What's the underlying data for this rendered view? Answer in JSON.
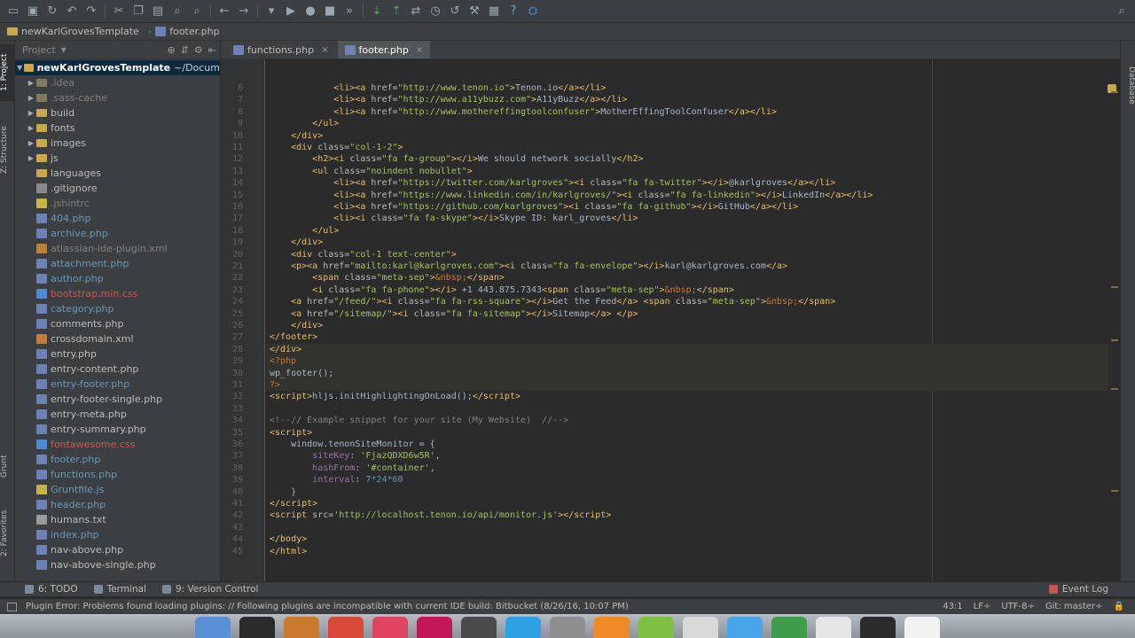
{
  "breadcrumb": {
    "project": "newKarlGrovesTemplate",
    "file": "footer.php"
  },
  "toolbar": {
    "icons": [
      "open-folder-icon",
      "save-icon",
      "sync-icon",
      "undo-icon",
      "redo-icon",
      "cut-icon",
      "copy-icon",
      "paste-icon",
      "find-icon",
      "replace-icon",
      "back-icon",
      "forward-icon",
      "run-config-icon",
      "run-icon",
      "debug-icon",
      "stop-icon",
      "step-icon",
      "vcs-update-icon",
      "vcs-commit-icon",
      "vcs-compare-icon",
      "vcs-history-icon",
      "revert-icon",
      "settings-icon",
      "structure-icon",
      "help-icon",
      "plugin-icon",
      "search-everywhere-icon"
    ]
  },
  "left_strip": {
    "project_tab": "1: Project",
    "structure_tab": "Z: Structure",
    "grunt_tab": "Grunt",
    "favorites_tab": "2: Favorites"
  },
  "right_strip": {
    "database_tab": "Database"
  },
  "project_panel": {
    "header": "Project",
    "root": "newKarlGrovesTemplate",
    "root_path": "~/Docum",
    "items": [
      {
        "name": ".idea",
        "kind": "folder",
        "dim": true,
        "expandable": true
      },
      {
        "name": ".sass-cache",
        "kind": "folder",
        "dim": true,
        "expandable": true
      },
      {
        "name": "build",
        "kind": "folder",
        "expandable": true
      },
      {
        "name": "fonts",
        "kind": "folder",
        "expandable": true
      },
      {
        "name": "images",
        "kind": "folder",
        "expandable": true
      },
      {
        "name": "js",
        "kind": "folder",
        "expandable": true
      },
      {
        "name": "languages",
        "kind": "folder",
        "expandable": false
      },
      {
        "name": ".gitignore",
        "kind": "git",
        "color": "white"
      },
      {
        "name": ".jshintrc",
        "kind": "js",
        "color": "gray"
      },
      {
        "name": "404.php",
        "kind": "php",
        "color": "blue"
      },
      {
        "name": "archive.php",
        "kind": "php",
        "color": "blue"
      },
      {
        "name": "atlassian-ide-plugin.xml",
        "kind": "xml",
        "color": "gray"
      },
      {
        "name": "attachment.php",
        "kind": "php",
        "color": "blue"
      },
      {
        "name": "author.php",
        "kind": "php",
        "color": "blue"
      },
      {
        "name": "bootstrap.min.css",
        "kind": "css",
        "color": "red"
      },
      {
        "name": "category.php",
        "kind": "php",
        "color": "blue"
      },
      {
        "name": "comments.php",
        "kind": "php",
        "color": "white"
      },
      {
        "name": "crossdomain.xml",
        "kind": "xml",
        "color": "white"
      },
      {
        "name": "entry.php",
        "kind": "php",
        "color": "white"
      },
      {
        "name": "entry-content.php",
        "kind": "php",
        "color": "white"
      },
      {
        "name": "entry-footer.php",
        "kind": "php",
        "color": "blue"
      },
      {
        "name": "entry-footer-single.php",
        "kind": "php",
        "color": "white"
      },
      {
        "name": "entry-meta.php",
        "kind": "php",
        "color": "white"
      },
      {
        "name": "entry-summary.php",
        "kind": "php",
        "color": "white"
      },
      {
        "name": "fontawesome.css",
        "kind": "css",
        "color": "red"
      },
      {
        "name": "footer.php",
        "kind": "php",
        "color": "blue"
      },
      {
        "name": "functions.php",
        "kind": "php",
        "color": "blue"
      },
      {
        "name": "Gruntfile.js",
        "kind": "js",
        "color": "blue"
      },
      {
        "name": "header.php",
        "kind": "php",
        "color": "blue"
      },
      {
        "name": "humans.txt",
        "kind": "txt",
        "color": "white"
      },
      {
        "name": "index.php",
        "kind": "php",
        "color": "blue"
      },
      {
        "name": "nav-above.php",
        "kind": "php",
        "color": "white"
      },
      {
        "name": "nav-above-single.php",
        "kind": "php",
        "color": "white"
      }
    ]
  },
  "editor_tabs": [
    {
      "label": "functions.php",
      "active": false
    },
    {
      "label": "footer.php",
      "active": true
    }
  ],
  "code_lines": [
    {
      "n": "6",
      "h": "            <span class=\"tag\">&lt;li&gt;&lt;a </span><span class=\"attr\">href=</span><span class=\"str\">\"http://www.tenon.io\"</span><span class=\"tag\">&gt;</span><span class=\"txt\">Tenon.io</span><span class=\"tag\">&lt;/a&gt;&lt;/li&gt;</span>"
    },
    {
      "n": "7",
      "h": "            <span class=\"tag\">&lt;li&gt;&lt;a </span><span class=\"attr\">href=</span><span class=\"str\">\"http://www.a11ybuzz.com\"</span><span class=\"tag\">&gt;</span><span class=\"txt\">A11yBuzz</span><span class=\"tag\">&lt;/a&gt;&lt;/li&gt;</span>"
    },
    {
      "n": "8",
      "h": "            <span class=\"tag\">&lt;li&gt;&lt;a </span><span class=\"attr\">href=</span><span class=\"str\">\"http://www.mothereffingtoolconfuser\"</span><span class=\"tag\">&gt;</span><span class=\"txt\">MotherEffingToolConfuser</span><span class=\"tag\">&lt;/a&gt;&lt;/li&gt;</span>"
    },
    {
      "n": "9",
      "h": "        <span class=\"tag\">&lt;/ul&gt;</span>"
    },
    {
      "n": "10",
      "h": "    <span class=\"tag\">&lt;/div&gt;</span>"
    },
    {
      "n": "11",
      "h": "    <span class=\"tag\">&lt;div </span><span class=\"attr\">class=</span><span class=\"str\">\"col-1-2\"</span><span class=\"tag\">&gt;</span>"
    },
    {
      "n": "12",
      "h": "        <span class=\"tag\">&lt;h2&gt;&lt;i </span><span class=\"attr\">class=</span><span class=\"str\">\"fa fa-group\"</span><span class=\"tag\">&gt;&lt;/i&gt;</span><span class=\"txt\">We should network socially</span><span class=\"tag\">&lt;/h2&gt;</span>"
    },
    {
      "n": "13",
      "h": "        <span class=\"tag\">&lt;ul </span><span class=\"attr\">class=</span><span class=\"str\">\"noindent nobullet\"</span><span class=\"tag\">&gt;</span>"
    },
    {
      "n": "14",
      "h": "            <span class=\"tag\">&lt;li&gt;&lt;a </span><span class=\"attr\">href=</span><span class=\"str\">\"https://twitter.com/karlgroves\"</span><span class=\"tag\">&gt;&lt;i </span><span class=\"attr\">class=</span><span class=\"str\">\"fa fa-twitter\"</span><span class=\"tag\">&gt;&lt;/i&gt;</span><span class=\"txt\">@karlgroves</span><span class=\"tag\">&lt;/a&gt;&lt;/li&gt;</span>"
    },
    {
      "n": "15",
      "h": "            <span class=\"tag\">&lt;li&gt;&lt;a </span><span class=\"attr\">href=</span><span class=\"str\">\"https://www.linkedin.com/in/karlgroves/\"</span><span class=\"tag\">&gt;&lt;i </span><span class=\"attr\">class=</span><span class=\"str\">\"fa fa-linkedin\"</span><span class=\"tag\">&gt;&lt;/i&gt;</span><span class=\"txt\">LinkedIn</span><span class=\"tag\">&lt;/a&gt;&lt;/li&gt;</span>"
    },
    {
      "n": "16",
      "h": "            <span class=\"tag\">&lt;li&gt;&lt;a </span><span class=\"attr\">href=</span><span class=\"str\">\"https://github.com/karlgroves\"</span><span class=\"tag\">&gt;&lt;i </span><span class=\"attr\">class=</span><span class=\"str\">\"fa fa-github\"</span><span class=\"tag\">&gt;&lt;/i&gt;</span><span class=\"txt\">GitHub</span><span class=\"tag\">&lt;/a&gt;&lt;/li&gt;</span>"
    },
    {
      "n": "17",
      "h": "            <span class=\"tag\">&lt;li&gt;&lt;i </span><span class=\"attr\">class=</span><span class=\"str\">\"fa fa-skype\"</span><span class=\"tag\">&gt;&lt;/i&gt;</span><span class=\"txt\">Skype ID: karl_groves</span><span class=\"tag\">&lt;/li&gt;</span>"
    },
    {
      "n": "18",
      "h": "        <span class=\"tag\">&lt;/ul&gt;</span>"
    },
    {
      "n": "19",
      "h": "    <span class=\"tag\">&lt;/div&gt;</span>"
    },
    {
      "n": "20",
      "h": "    <span class=\"tag\">&lt;div </span><span class=\"attr\">class=</span><span class=\"str\">\"col-1 text-center\"</span><span class=\"tag\">&gt;</span>"
    },
    {
      "n": "21",
      "h": "    <span class=\"tag\">&lt;p&gt;&lt;a </span><span class=\"attr\">href=</span><span class=\"str\">\"mailto:karl@karlgroves.com\"</span><span class=\"tag\">&gt;&lt;i </span><span class=\"attr\">class=</span><span class=\"str\">\"fa fa-envelope\"</span><span class=\"tag\">&gt;&lt;/i&gt;</span><span class=\"txt\">karl@karlgroves.com</span><span class=\"tag\">&lt;/a&gt;</span>"
    },
    {
      "n": "22",
      "h": "        <span class=\"tag\">&lt;span </span><span class=\"attr\">class=</span><span class=\"str\">\"meta-sep\"</span><span class=\"tag\">&gt;</span><span class=\"php\">&amp;nbsp;</span><span class=\"tag\">&lt;/span&gt;</span>"
    },
    {
      "n": "23",
      "h": "        <span class=\"tag\">&lt;i </span><span class=\"attr\">class=</span><span class=\"str\">\"fa fa-phone\"</span><span class=\"tag\">&gt;&lt;/i&gt;</span><span class=\"txt\"> +1 443.875.7343</span><span class=\"tag\">&lt;span </span><span class=\"attr\">class=</span><span class=\"str\">\"meta-sep\"</span><span class=\"tag\">&gt;</span><span class=\"php\">&amp;nbsp;</span><span class=\"tag\">&lt;/span&gt;</span>"
    },
    {
      "n": "24",
      "h": "    <span class=\"tag\">&lt;a </span><span class=\"attr\">href=</span><span class=\"str\">\"/feed/\"</span><span class=\"tag\">&gt;&lt;i </span><span class=\"attr\">class=</span><span class=\"str\">\"fa fa-rss-square\"</span><span class=\"tag\">&gt;&lt;/i&gt;</span><span class=\"txt\">Get the Feed</span><span class=\"tag\">&lt;/a&gt; &lt;span </span><span class=\"attr\">class=</span><span class=\"str\">\"meta-sep\"</span><span class=\"tag\">&gt;</span><span class=\"php\">&amp;nbsp;</span><span class=\"tag\">&lt;/span&gt;</span>"
    },
    {
      "n": "25",
      "h": "    <span class=\"tag\">&lt;a </span><span class=\"attr\">href=</span><span class=\"str\">\"/sitemap/\"</span><span class=\"tag\">&gt;&lt;i </span><span class=\"attr\">class=</span><span class=\"str\">\"fa fa-sitemap\"</span><span class=\"tag\">&gt;&lt;/i&gt;</span><span class=\"txt\">Sitemap</span><span class=\"tag\">&lt;/a&gt; &lt;/p&gt;</span>"
    },
    {
      "n": "26",
      "h": "    <span class=\"tag\">&lt;/div&gt;</span>"
    },
    {
      "n": "27",
      "h": "<span class=\"tag\">&lt;/footer&gt;</span>"
    },
    {
      "n": "28",
      "h": "<span class=\"tag\">&lt;/div&gt;</span>"
    },
    {
      "n": "29",
      "h": "<span class=\"php\">&lt;?php</span>"
    },
    {
      "n": "30",
      "h": "<span class=\"txt\">wp_footer();</span>"
    },
    {
      "n": "31",
      "h": "<span class=\"php\">?&gt;</span>"
    },
    {
      "n": "32",
      "h": "<span class=\"tag\">&lt;script&gt;</span><span class=\"txt\">hljs.initHighlightingOnLoad();</span><span class=\"tag\">&lt;/script&gt;</span>"
    },
    {
      "n": "33",
      "h": ""
    },
    {
      "n": "34",
      "h": "<span class=\"cmt\">&lt;!--// Example snippet for your site (My Website)  //--&gt;</span>"
    },
    {
      "n": "35",
      "h": "<span class=\"tag\">&lt;script&gt;</span>"
    },
    {
      "n": "36",
      "h": "    <span class=\"txt\">window.tenonSiteMonitor = {</span>"
    },
    {
      "n": "37",
      "h": "        <span class=\"prop\">siteKey</span><span class=\"txt\">: </span><span class=\"str\">'FjazQDXD6w5R'</span><span class=\"txt\">,</span>"
    },
    {
      "n": "38",
      "h": "        <span class=\"prop\">hashFrom</span><span class=\"txt\">: </span><span class=\"str\">'#container'</span><span class=\"txt\">,</span>"
    },
    {
      "n": "39",
      "h": "        <span class=\"prop\">interval</span><span class=\"txt\">: </span><span class=\"num\">7*24*60</span>"
    },
    {
      "n": "40",
      "h": "    <span class=\"txt\">}</span>"
    },
    {
      "n": "41",
      "h": "<span class=\"tag\">&lt;/script&gt;</span>"
    },
    {
      "n": "42",
      "h": "<span class=\"tag\">&lt;script </span><span class=\"attr\">src=</span><span class=\"str\">'http://localhost.tenon.io/api/monitor.js'</span><span class=\"tag\">&gt;&lt;/script&gt;</span>"
    },
    {
      "n": "43",
      "h": ""
    },
    {
      "n": "44",
      "h": "<span class=\"tag\">&lt;/body&gt;</span>"
    },
    {
      "n": "45",
      "h": "<span class=\"tag\">&lt;/html&gt;</span>"
    }
  ],
  "bottom_tabs": {
    "todo": "6: TODO",
    "terminal": "Terminal",
    "vcs": "9: Version Control",
    "event_log": "Event Log"
  },
  "status": {
    "message": "Plugin Error: Problems found loading plugins: // Following plugins are incompatible with current IDE build: Bitbucket (8/26/16, 10:07 PM)",
    "position": "43:1",
    "line_sep": "LF÷",
    "encoding": "UTF-8÷",
    "git": "Git: master÷"
  },
  "dock_colors": [
    "#5b8fd6",
    "#2a2a2a",
    "#c97a2b",
    "#d84b3a",
    "#e0445e",
    "#c2185b",
    "#4a4a4a",
    "#2fa0e3",
    "#8e8e8e",
    "#f08a24",
    "#7cc140",
    "#d9d9d9",
    "#48a6e8",
    "#3e9c4a",
    "#e6e6e6",
    "#2b2b2b",
    "#f2f2f2"
  ]
}
